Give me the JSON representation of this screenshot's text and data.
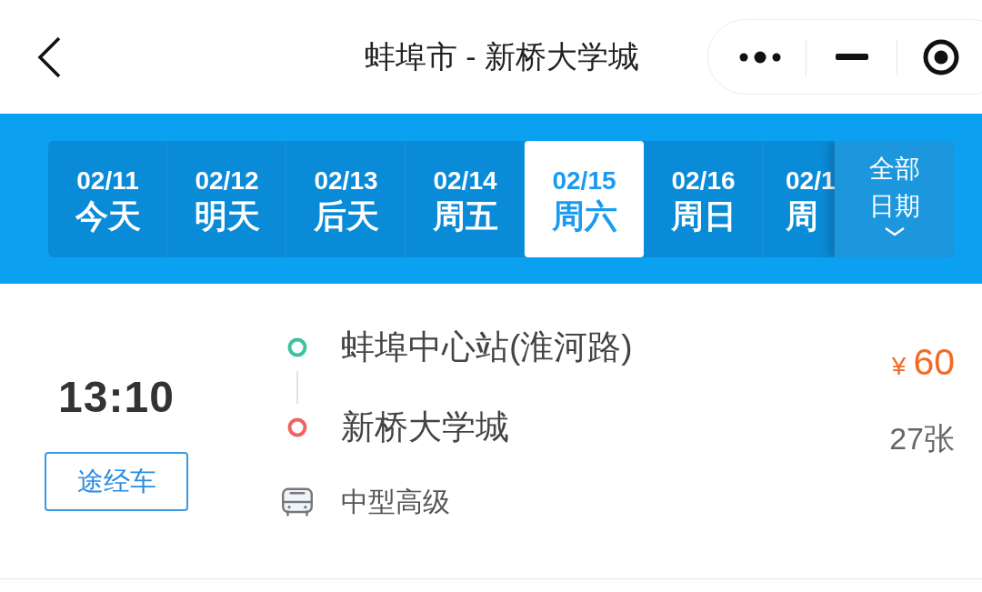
{
  "nav_bar": {
    "title": "蚌埠市 - 新桥大学城"
  },
  "date_tabs": [
    {
      "date": "02/11",
      "day": "今天",
      "selected": false
    },
    {
      "date": "02/12",
      "day": "明天",
      "selected": false
    },
    {
      "date": "02/13",
      "day": "后天",
      "selected": false
    },
    {
      "date": "02/14",
      "day": "周五",
      "selected": false
    },
    {
      "date": "02/15",
      "day": "周六",
      "selected": true
    },
    {
      "date": "02/16",
      "day": "周日",
      "selected": false
    },
    {
      "date": "02/1",
      "day": "周",
      "selected": false
    }
  ],
  "all_dates": {
    "label": "全部日期"
  },
  "trips": [
    {
      "departure_time": "13:10",
      "tag": "途经车",
      "stops": [
        {
          "name": "蚌埠中心站(淮河路)",
          "color": "#3cc3a0"
        },
        {
          "name": "新桥大学城",
          "color": "#f06464"
        }
      ],
      "bus_type": "中型高级",
      "currency": "¥",
      "price": "60",
      "seats": "27张"
    }
  ]
}
